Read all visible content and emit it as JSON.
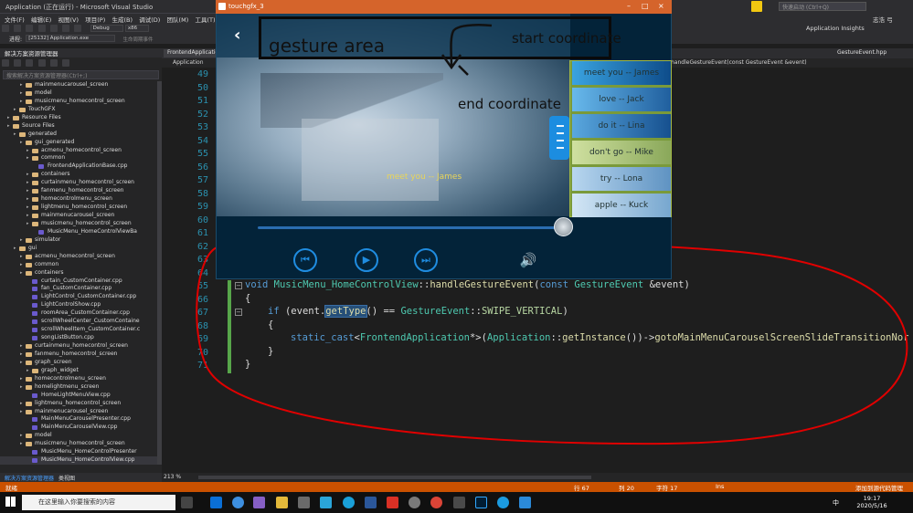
{
  "vs": {
    "title": "Application (正在运行) - Microsoft Visual Studio",
    "menu": [
      "文件(F)",
      "编辑(E)",
      "视图(V)",
      "项目(P)",
      "生成(B)",
      "调试(D)",
      "团队(M)",
      "工具(T)"
    ],
    "process_label": "进程:",
    "process_value": "[25132] Application.exe",
    "thread_label": "生命周期事件",
    "thread_value": "[12200] 主线程",
    "config": "Debug",
    "platform": "x86",
    "search_placeholder": "快速启动 (Ctrl+Q)",
    "user": "志浩 弓",
    "insights": "Application Insights"
  },
  "solution": {
    "header": "解决方案资源管理器",
    "search_placeholder": "搜索解决方案资源管理器(Ctrl+;)",
    "tabs": [
      "解决方案资源管理器",
      "类视图"
    ],
    "tree": [
      {
        "label": "mainmenucarousel_screen",
        "depth": 4,
        "kind": "folder"
      },
      {
        "label": "model",
        "depth": 4,
        "kind": "folder"
      },
      {
        "label": "musicmenu_homecontrol_screen",
        "depth": 4,
        "kind": "folder"
      },
      {
        "label": "TouchGFX",
        "depth": 3,
        "kind": "folder"
      },
      {
        "label": "Resource Files",
        "depth": 2,
        "kind": "folder"
      },
      {
        "label": "Source Files",
        "depth": 2,
        "kind": "folder"
      },
      {
        "label": "generated",
        "depth": 3,
        "kind": "folder"
      },
      {
        "label": "gui_generated",
        "depth": 4,
        "kind": "folder"
      },
      {
        "label": "acmenu_homecontrol_screen",
        "depth": 5,
        "kind": "folder"
      },
      {
        "label": "common",
        "depth": 5,
        "kind": "folder"
      },
      {
        "label": "FrontendApplicationBase.cpp",
        "depth": 6,
        "kind": "cpp"
      },
      {
        "label": "containers",
        "depth": 5,
        "kind": "folder"
      },
      {
        "label": "curtainmenu_homecontrol_screen",
        "depth": 5,
        "kind": "folder"
      },
      {
        "label": "fanmenu_homecontrol_screen",
        "depth": 5,
        "kind": "folder"
      },
      {
        "label": "homecontrolmenu_screen",
        "depth": 5,
        "kind": "folder"
      },
      {
        "label": "lightmenu_homecontrol_screen",
        "depth": 5,
        "kind": "folder"
      },
      {
        "label": "mainmenucarousel_screen",
        "depth": 5,
        "kind": "folder"
      },
      {
        "label": "musicmenu_homecontrol_screen",
        "depth": 5,
        "kind": "folder"
      },
      {
        "label": "MusicMenu_HomeControlViewBa",
        "depth": 6,
        "kind": "cpp"
      },
      {
        "label": "simulator",
        "depth": 4,
        "kind": "folder"
      },
      {
        "label": "gui",
        "depth": 3,
        "kind": "folder"
      },
      {
        "label": "acmenu_homecontrol_screen",
        "depth": 4,
        "kind": "folder"
      },
      {
        "label": "common",
        "depth": 4,
        "kind": "folder"
      },
      {
        "label": "containers",
        "depth": 4,
        "kind": "folder"
      },
      {
        "label": "curtain_CustomContainer.cpp",
        "depth": 5,
        "kind": "cpp"
      },
      {
        "label": "fan_CustomContainer.cpp",
        "depth": 5,
        "kind": "cpp"
      },
      {
        "label": "LightControl_CustomContainer.cpp",
        "depth": 5,
        "kind": "cpp"
      },
      {
        "label": "LightControlShow.cpp",
        "depth": 5,
        "kind": "cpp"
      },
      {
        "label": "roomArea_CustomContainer.cpp",
        "depth": 5,
        "kind": "cpp"
      },
      {
        "label": "scrollWheelCenter_CustomContaine",
        "depth": 5,
        "kind": "cpp"
      },
      {
        "label": "scrollWheelItem_CustomContainer.c",
        "depth": 5,
        "kind": "cpp"
      },
      {
        "label": "songListButton.cpp",
        "depth": 5,
        "kind": "cpp"
      },
      {
        "label": "curtainmenu_homecontrol_screen",
        "depth": 4,
        "kind": "folder"
      },
      {
        "label": "fanmenu_homecontrol_screen",
        "depth": 4,
        "kind": "folder"
      },
      {
        "label": "graph_screen",
        "depth": 4,
        "kind": "folder"
      },
      {
        "label": "graph_widget",
        "depth": 5,
        "kind": "folder"
      },
      {
        "label": "homecontrolmenu_screen",
        "depth": 4,
        "kind": "folder"
      },
      {
        "label": "homelightmenu_screen",
        "depth": 4,
        "kind": "folder"
      },
      {
        "label": "HomeLightMenuView.cpp",
        "depth": 5,
        "kind": "cpp"
      },
      {
        "label": "lightmenu_homecontrol_screen",
        "depth": 4,
        "kind": "folder"
      },
      {
        "label": "mainmenucarousel_screen",
        "depth": 4,
        "kind": "folder"
      },
      {
        "label": "MainMenuCarouselPresenter.cpp",
        "depth": 5,
        "kind": "cpp"
      },
      {
        "label": "MainMenuCarouselView.cpp",
        "depth": 5,
        "kind": "cpp"
      },
      {
        "label": "model",
        "depth": 4,
        "kind": "folder"
      },
      {
        "label": "musicmenu_homecontrol_screen",
        "depth": 4,
        "kind": "folder"
      },
      {
        "label": "MusicMenu_HomeControlPresenter",
        "depth": 5,
        "kind": "cpp"
      },
      {
        "label": "MusicMenu_HomeControlView.cpp",
        "depth": 5,
        "kind": "cpp"
      }
    ]
  },
  "editor": {
    "tabs": [
      "FrontendApplicatio",
      "GestureEvent.hpp"
    ],
    "nav_left": "Application",
    "nav_right": "handleGestureEvent(const GestureEvent &event)",
    "zoom": "213 %",
    "lines": [
      {
        "n": "49"
      },
      {
        "n": "50"
      },
      {
        "n": "51"
      },
      {
        "n": "52"
      },
      {
        "n": "53"
      },
      {
        "n": "54"
      },
      {
        "n": "55"
      },
      {
        "n": "56"
      },
      {
        "n": "57"
      },
      {
        "n": "58"
      },
      {
        "n": "59"
      },
      {
        "n": "60"
      },
      {
        "n": "61"
      },
      {
        "n": "62"
      },
      {
        "n": "63"
      },
      {
        "n": "64"
      },
      {
        "n": "65"
      },
      {
        "n": "66"
      },
      {
        "n": "67"
      },
      {
        "n": "68"
      },
      {
        "n": "69"
      },
      {
        "n": "70"
      },
      {
        "n": "71"
      }
    ],
    "code": {
      "l65_kw": "void",
      "l65_cls": "MusicMenu_HomeControlView",
      "l65_sep": "::",
      "l65_fn": "handleGestureEvent",
      "l65_p1": "(",
      "l65_const": "const",
      "l65_ty": "GestureEvent",
      "l65_rest": " &event)",
      "l66": "{",
      "l67_if": "if",
      "l67_a": " (event.",
      "l67_fn": "getType",
      "l67_b": "() == ",
      "l67_ty": "GestureEvent",
      "l67_c": "::",
      "l67_en": "SWIPE_VERTICAL",
      "l67_d": ")",
      "l68": "{",
      "l69_kw": "static_cast",
      "l69_a": "<",
      "l69_ty": "FrontendApplication",
      "l69_b": "*>(",
      "l69_ty2": "Application",
      "l69_c": "::",
      "l69_fn": "getInstance",
      "l69_d": "())->",
      "l69_fn2": "gotoMainMenuCarouselScreenSlideTransitionNor",
      "l70": "}",
      "l71": "}"
    }
  },
  "touchgfx": {
    "title": "touchgfx_3",
    "gesture_area": "gesture area",
    "start_coordinate": "start coordinate",
    "end_coordinate": "end coordinate",
    "now_playing": "meet you -- James",
    "playlist": [
      "meet you -- James",
      "love -- Jack",
      "do it -- Lina",
      "don't go -- Mike",
      "try -- Lona",
      "apple -- Kuck"
    ],
    "progress": 1.0
  },
  "status": {
    "ready": "就绪",
    "line": "行 67",
    "col": "列 20",
    "char": "字符 17",
    "mode": "Ins",
    "source_control": "添加到源代码管理"
  },
  "taskbar": {
    "search_placeholder": "在这里输入你要搜索的内容",
    "time": "19:17",
    "date": "2020/5/16",
    "ime": "中"
  },
  "colors": {
    "status_bar": "#ca5100",
    "touchgfx_title": "#d5642b",
    "accent_blue": "#1f8ce0",
    "annotation_red": "#e00000"
  }
}
